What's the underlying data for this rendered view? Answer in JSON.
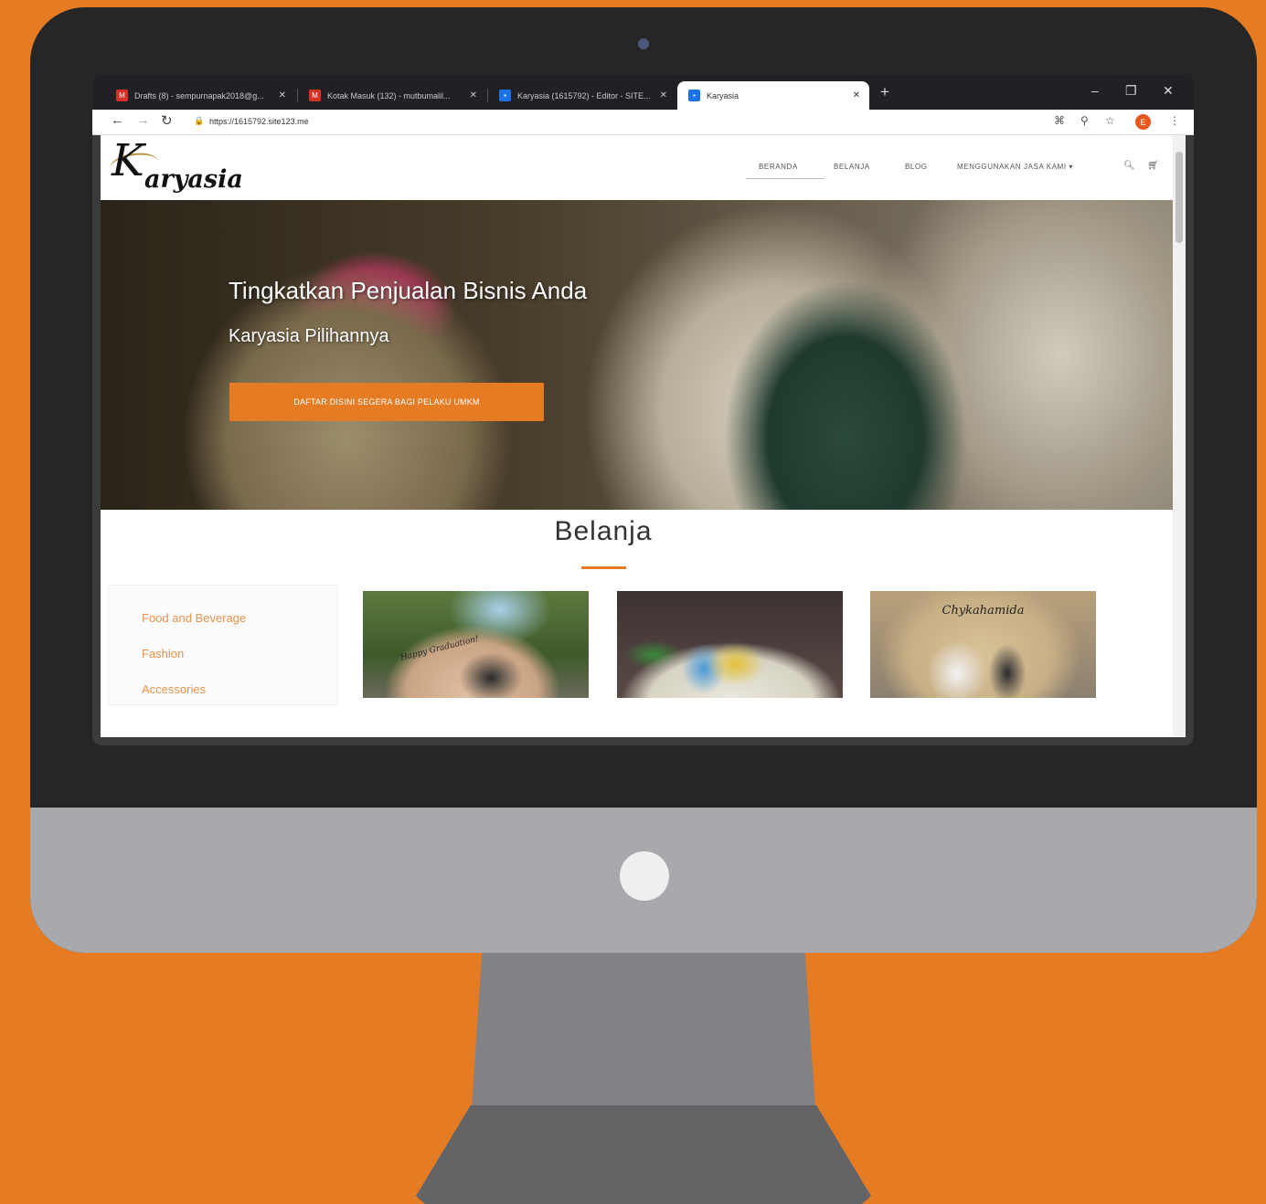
{
  "browser": {
    "tabs": [
      {
        "title": "Drafts (8) - sempurnapak2018@g...",
        "favicon_color": "#d93025"
      },
      {
        "title": "Kotak Masuk (132) - mutbumalil...",
        "favicon_color": "#d93025"
      },
      {
        "title": "Karyasia (1615792) - Editor - SITE...",
        "favicon_color": "#1a73e8"
      },
      {
        "title": "Karyasia",
        "favicon_color": "#1a73e8"
      }
    ],
    "new_tab_symbol": "+",
    "url": "https://1615792.site123.me",
    "profile_initial": "E"
  },
  "site": {
    "logo_initial": "K",
    "logo_rest": "aryasia",
    "nav": [
      "BERANDA",
      "BELANJA",
      "BLOG",
      "MENGGUNAKAN JASA KAMI ▾"
    ],
    "hero": {
      "title": "Tingkatkan Penjualan Bisnis Anda",
      "subtitle": "Karyasia Pilihannya",
      "cta": "DAFTAR DISINI SEGERA BAGI PELAKU UMKM"
    },
    "shop": {
      "title": "Belanja",
      "categories": [
        "Food and Beverage",
        "Fashion",
        "Accessories"
      ],
      "products": [
        {
          "caption": "Happy Graduation!"
        },
        {
          "caption": ""
        },
        {
          "caption": "Chykahamida"
        }
      ]
    }
  },
  "colors": {
    "accent": "#e57c23",
    "bezel": "#262626",
    "chin": "#a8a9ac"
  },
  "icons": [
    "back-arrow-icon",
    "forward-arrow-icon",
    "reload-icon",
    "lock-icon",
    "translate-icon",
    "zoom-icon",
    "star-icon",
    "menu-dots-icon",
    "search-icon",
    "cart-icon",
    "minimize-icon",
    "maximize-icon",
    "close-icon"
  ]
}
